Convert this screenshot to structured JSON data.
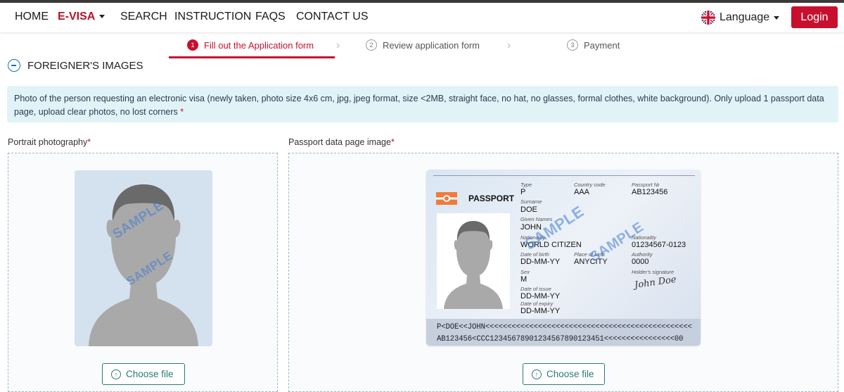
{
  "nav": {
    "home": "HOME",
    "evisa": "E-VISA",
    "search": "SEARCH",
    "instruction": "INSTRUCTION",
    "faqs": "FAQS",
    "contact": "CONTACT US",
    "language": "Language",
    "login": "Login"
  },
  "steps": [
    {
      "num": "1",
      "label": "Fill out the Application form"
    },
    {
      "num": "2",
      "label": "Review application form"
    },
    {
      "num": "3",
      "label": "Payment"
    }
  ],
  "section": {
    "title": "FOREIGNER'S IMAGES"
  },
  "notice": {
    "text": "Photo of the person requesting an electronic visa (newly taken, photo size 4x6 cm, jpg, jpeg format, size <2MB, straight face, no hat, no glasses, formal clothes, white background). Only upload 1 passport data page, upload clear photos, no lost corners",
    "required_mark": "*"
  },
  "portrait": {
    "label": "Portrait photography",
    "required_mark": "*",
    "watermark": "SAMPLE",
    "choose": "Choose file"
  },
  "passport_upload": {
    "label": "Passport data page image",
    "required_mark": "*",
    "choose": "Choose file"
  },
  "passport": {
    "header": "PASSPORT",
    "type_label": "Type",
    "type": "P",
    "country_label": "Country code",
    "country": "AAA",
    "number_label": "Passport №",
    "number": "AB123456",
    "surname_label": "Surname",
    "surname": "DOE",
    "given_label": "Given Names",
    "given": "JOHN",
    "nationality_label": "Nationality",
    "nationality": "WORLD CITIZEN",
    "personal_label": "Nationality",
    "personal": "01234567-0123",
    "dob_label": "Date of birth",
    "dob": "DD-MM-YY",
    "pob_label": "Place of birth",
    "pob": "ANYCITY",
    "authority_label": "Authority",
    "authority": "0000",
    "sex_label": "Sex",
    "sex": "M",
    "holder_sig_label": "Holder's signature",
    "signature": "John Doe",
    "issue_label": "Date of issue",
    "issue": "DD-MM-YY",
    "expiry_label": "Date of expiry",
    "expiry": "DD-MM-YY",
    "mrz1": "P<DOE<<JOHN<<<<<<<<<<<<<<<<<<<<<<<<<<<<<<<<<<<<<<<<<<<<<<<",
    "mrz2": "AB123456<CCC12345678901234567890123451<<<<<<<<<<<<<<<<00",
    "watermark": "SAMPLE"
  },
  "colors": {
    "brand": "#c8102e",
    "teal": "#2b7a78",
    "notice_bg": "#e2f3f8"
  }
}
